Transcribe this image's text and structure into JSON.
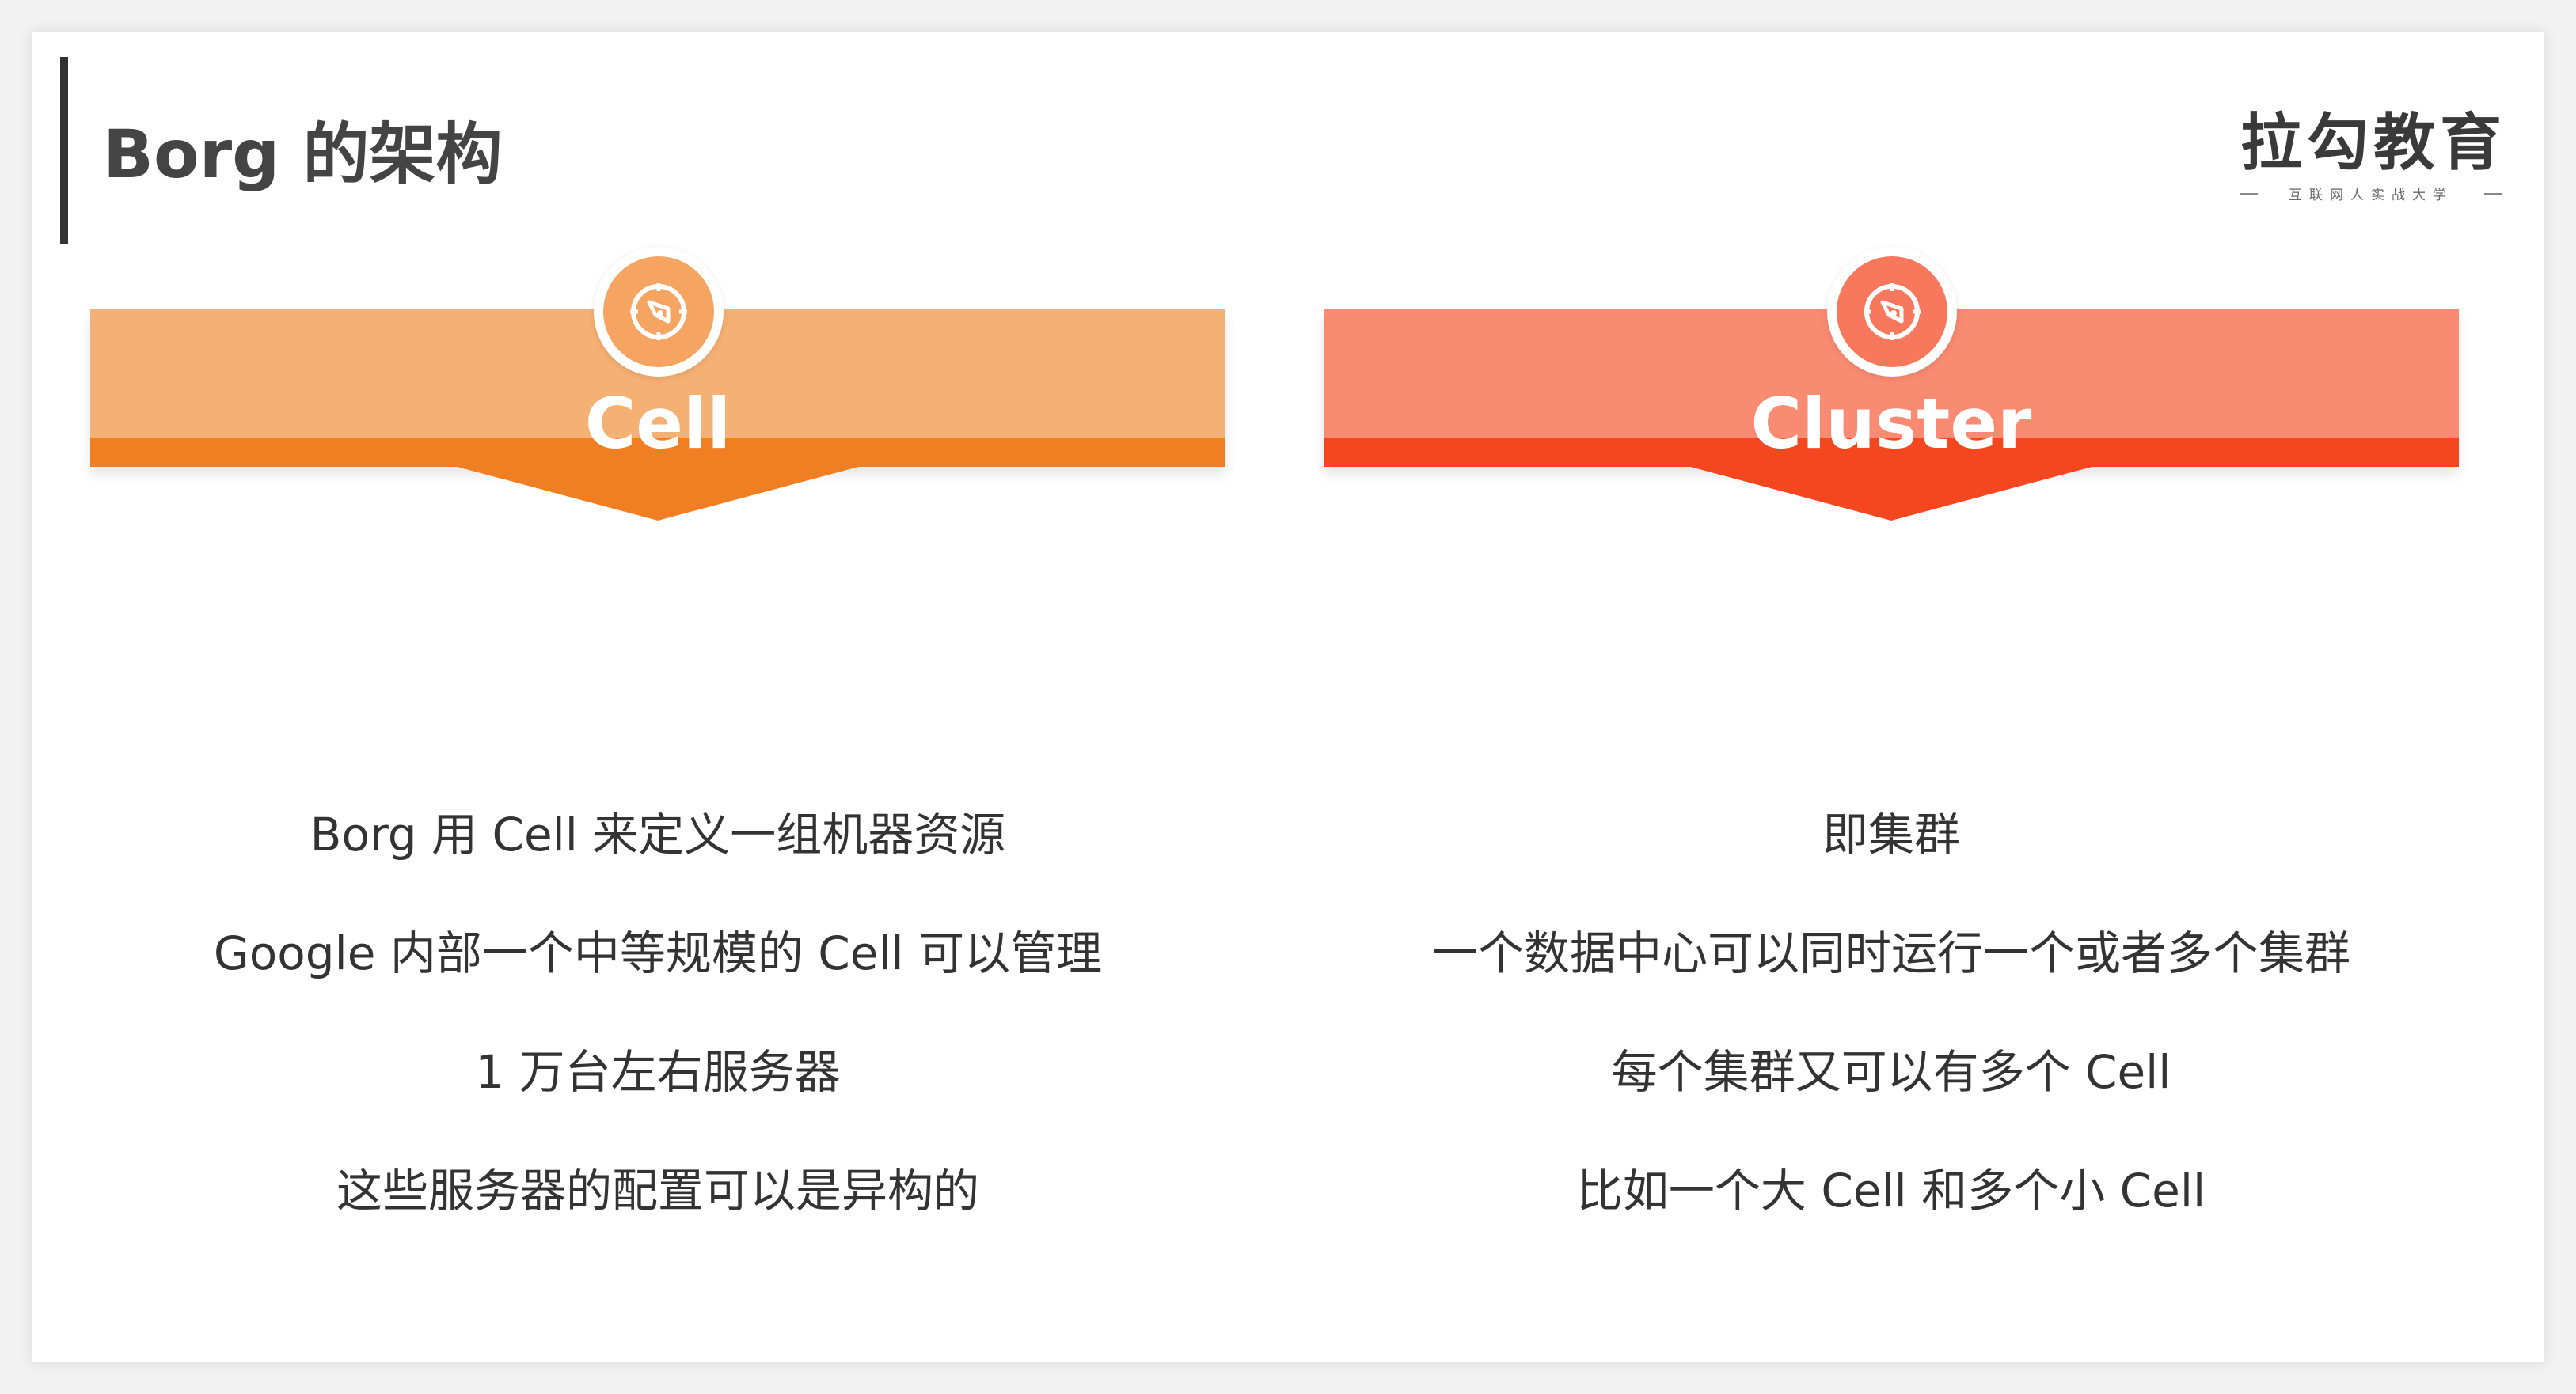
{
  "page": {
    "title": "Borg 的架构"
  },
  "logo": {
    "name": "拉勾教育",
    "tagline": "互联网人实战大学"
  },
  "cards": [
    {
      "title": "Cell",
      "icon": "compass-icon",
      "colors": {
        "banner": "#f5b073",
        "band": "#ef7f22"
      },
      "lines": [
        "Borg 用 Cell 来定义一组机器资源",
        "Google 内部一个中等规模的 Cell 可以管理",
        "1 万台左右服务器",
        "这些服务器的配置可以是异构的"
      ]
    },
    {
      "title": "Cluster",
      "icon": "compass-icon",
      "colors": {
        "banner": "#f98b72",
        "band": "#f4471f"
      },
      "lines": [
        "即集群",
        "一个数据中心可以同时运行一个或者多个集群",
        "每个集群又可以有多个 Cell",
        "比如一个大 Cell 和多个小 Cell"
      ]
    }
  ]
}
